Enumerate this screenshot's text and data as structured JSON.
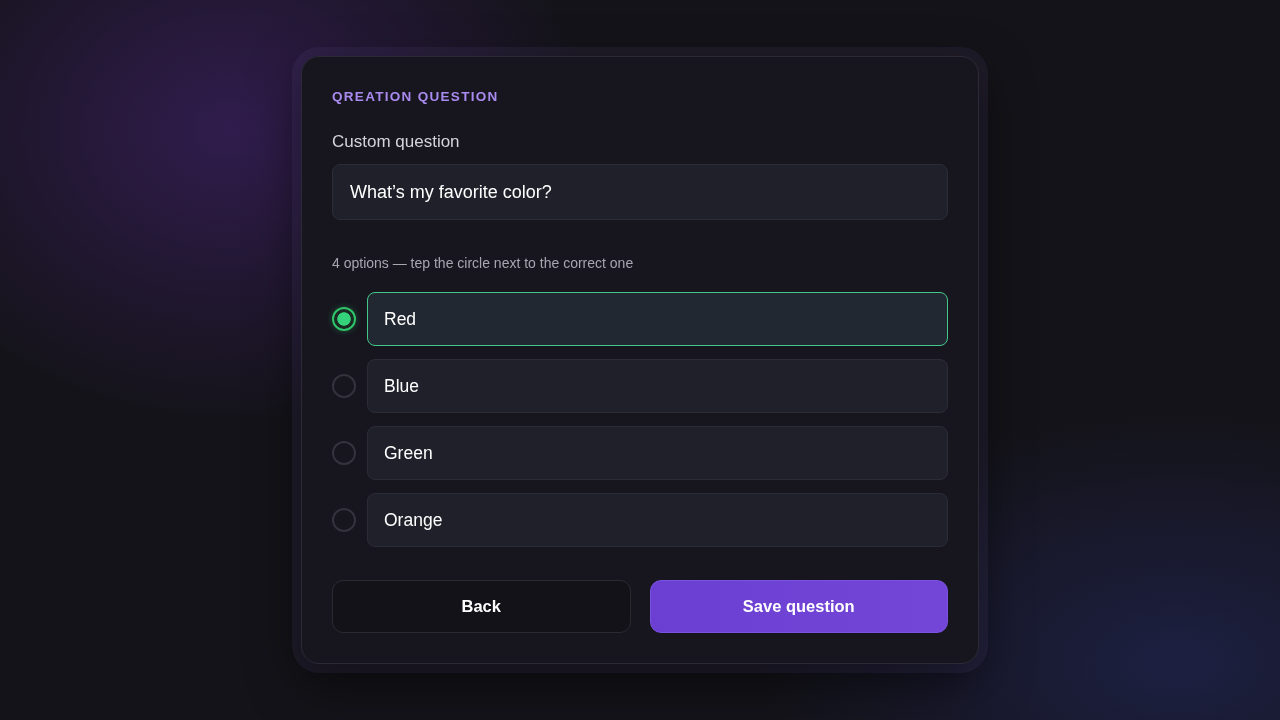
{
  "card": {
    "title": "QREATION QUESTION",
    "field_label": "Custom question",
    "question": {
      "value": "What’s my favorite color?"
    },
    "hint": "4 options — tep the circle next to the correct one",
    "options": [
      {
        "label": "Red",
        "selected": true
      },
      {
        "label": "Blue",
        "selected": false
      },
      {
        "label": "Green",
        "selected": false
      },
      {
        "label": "Orange",
        "selected": false
      }
    ],
    "buttons": [
      {
        "label": "Back",
        "kind": "secondary"
      },
      {
        "label": "Save question",
        "kind": "primary"
      }
    ]
  }
}
